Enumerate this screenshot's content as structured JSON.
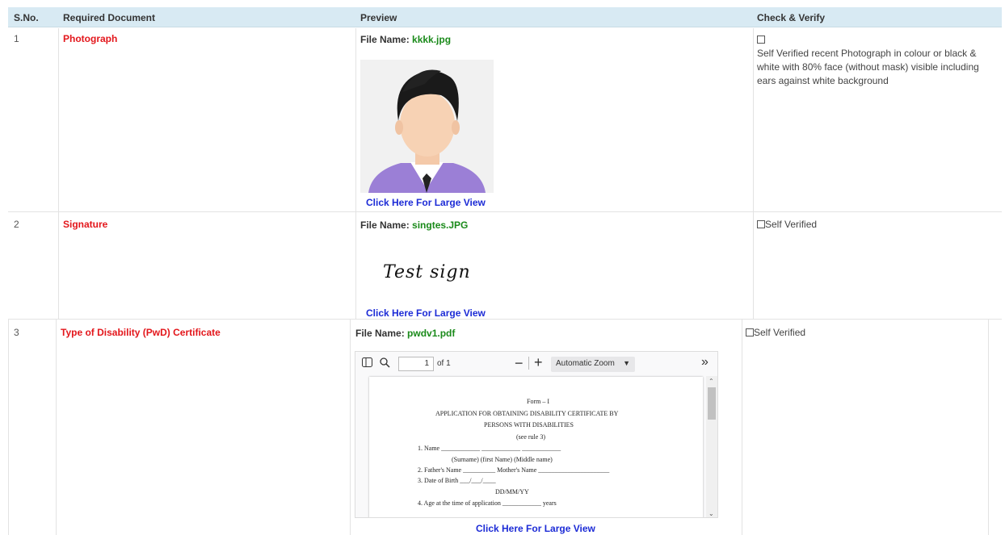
{
  "header": {
    "sno": "S.No.",
    "required_document": "Required Document",
    "preview": "Preview",
    "check_verify": "Check & Verify"
  },
  "rows": [
    {
      "sno": "1",
      "document": "Photograph",
      "file_label": "File Name:",
      "file_name": "kkkk.jpg",
      "large_view": "Click Here For Large View",
      "verify_text": "Self Verified recent Photograph in colour or black & white with 80% face (without mask) visible including ears against white background"
    },
    {
      "sno": "2",
      "document": "Signature",
      "file_label": "File Name:",
      "file_name": "singtes.JPG",
      "signature_text": "Test sign",
      "large_view": "Click Here For Large View",
      "verify_text": "Self Verified"
    },
    {
      "sno": "3",
      "document": "Type of Disability (PwD) Certificate",
      "file_label": "File Name:",
      "file_name": "pwdv1.pdf",
      "large_view": "Click Here For Large View",
      "verify_text": "Self Verified"
    }
  ],
  "pdf_viewer": {
    "page_number": "1",
    "page_count": "of 1",
    "zoom": "Automatic Zoom",
    "content": {
      "form_no": "Form – I",
      "title_line1": "APPLICATION FOR OBTAINING DISABILITY CERTIFICATE BY",
      "title_line2": "PERSONS WITH DISABILITIES",
      "rule": "(see rule 3)",
      "item1": "1.    Name ____________    ____________    ____________",
      "item1_sub": "(Surname)          (first Name)          (Middle name)",
      "item2": "2.    Father's Name __________  Mother's Name ______________________",
      "item3": "3.    Date of Birth ___/___/____",
      "item3_sub": "DD/MM/YY",
      "item4": "4.    Age at the time of application ____________ years"
    }
  }
}
